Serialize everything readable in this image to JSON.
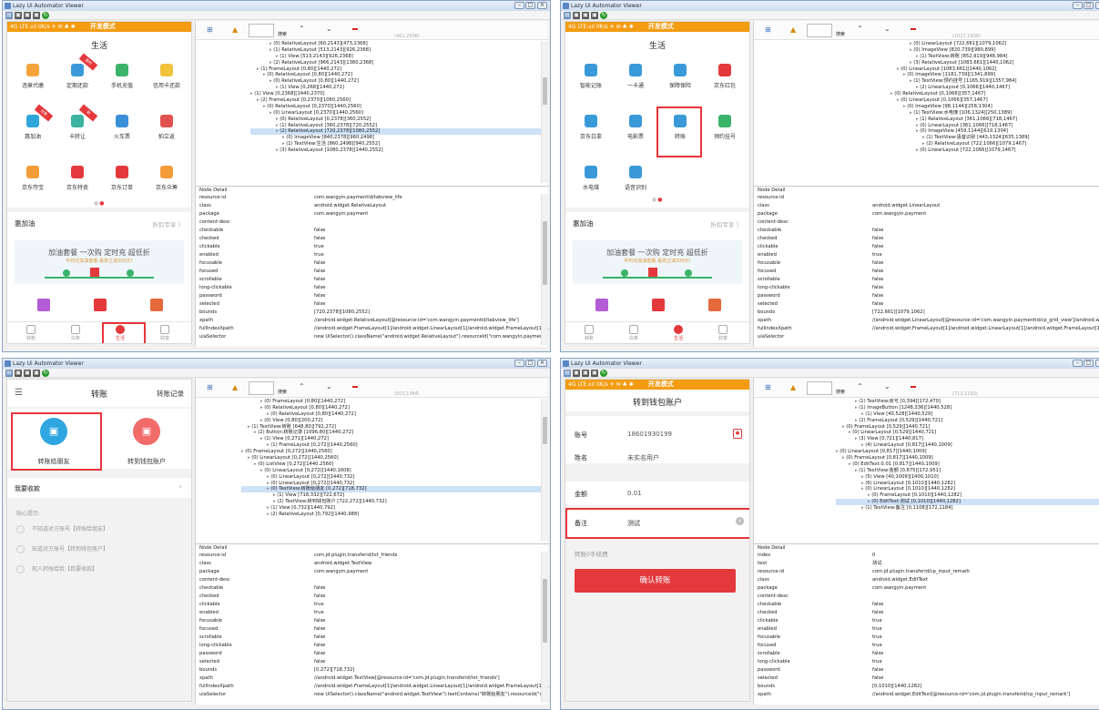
{
  "app": {
    "title": "Lazy Ui Automator Viewer",
    "search_label": "搜索"
  },
  "status": {
    "left": "4G LTE.ıııl 0K/s ✈ ✉ ♣ ✱",
    "dev_mode": "开发模式",
    "right": "◐ ◉ ⊙ ▮"
  },
  "panels": [
    {
      "coord_text": "(461,2506)",
      "phone_title": "生活",
      "grid": [
        {
          "label": "违章代缴",
          "color": "#f3a33a",
          "icon": "car-icon"
        },
        {
          "label": "定期还款",
          "color": "#3a9ad9",
          "icon": "clock-icon",
          "badge": "限时"
        },
        {
          "label": "手机充值",
          "color": "#3bb36a",
          "icon": "phone-charge-icon"
        },
        {
          "label": "信用卡还款",
          "color": "#f0c33a",
          "icon": "card-icon"
        },
        {
          "label": "惠加油",
          "color": "#2fa6d9",
          "icon": "fuel-icon",
          "badge": "优惠"
        },
        {
          "label": "卡转让",
          "color": "#3bb3a0",
          "icon": "card-transfer-icon",
          "badge": "新"
        },
        {
          "label": "火车票",
          "color": "#3a8fd9",
          "icon": "train-icon"
        },
        {
          "label": "拍立返",
          "color": "#e0524f",
          "icon": "camera-icon"
        },
        {
          "label": "京东夺宝",
          "color": "#f39c3a",
          "icon": "treasure-icon"
        },
        {
          "label": "京东特卖",
          "color": "#e4393c",
          "icon": "cart-icon"
        },
        {
          "label": "京东订单",
          "color": "#e4393c",
          "icon": "jd-icon"
        },
        {
          "label": "京东众筹",
          "color": "#f39c3a",
          "icon": "crowdfund-icon"
        }
      ],
      "section_title": "惠加油",
      "section_link": "折扣专享 〉",
      "banner_title": "加油套餐 一次购 定时充 超低折",
      "banner_sub": "中石化加油套餐 最高立减300元!",
      "nav": [
        "转账",
        "白条",
        "生活",
        "财富"
      ],
      "nav_active": 2,
      "tree": [
        "(0) RelativeLayout [60,2143][473,2368]",
        "(1) RelativeLayout [513,2143][926,2368]",
        "(1) View [513,2143][926,2368]",
        "(2) RelativeLayout [966,2143][1380,2368]",
        "(1) FrameLayout [0,80][1440,272]",
        "(0) RelativeLayout [0,80][1440,272]",
        "(0) RelativeLayout [0,80][1440,272]",
        "(1) View [0,268][1440,272]",
        "(1) View [0,2368][1440,2370]",
        "(2) FrameLayout [0,2370][1060,2560]",
        "(0) RelativeLayout [0,2370][1440,2560]",
        "(0) LinearLayout [0,2370][1440,2560]",
        "(0) RelativeLayout [0,2378][360,2552]",
        "(1) RelativeLayout [360,2378][720,2552]",
        "(2) RelativeLayout [720,2378][1080,2552]",
        "(0) ImageView [840,2378][960,2498]",
        "(1) TextView:生活 [860,2498][940,2552]",
        "(3) RelativeLayout [1080,2378][1440,2552]"
      ],
      "tree_sel": 14,
      "detail_header": "Node Detail",
      "details": [
        [
          "resource-id",
          "com.wangyin.paymentid/tabview_life"
        ],
        [
          "class",
          "android.widget.RelativeLayout"
        ],
        [
          "package",
          "com.wangyin.payment"
        ],
        [
          "content-desc",
          ""
        ],
        [
          "checkable",
          "false"
        ],
        [
          "checked",
          "false"
        ],
        [
          "clickable",
          "true"
        ],
        [
          "enabled",
          "true"
        ],
        [
          "focusable",
          "false"
        ],
        [
          "focused",
          "false"
        ],
        [
          "scrollable",
          "false"
        ],
        [
          "long-clickable",
          "false"
        ],
        [
          "password",
          "false"
        ],
        [
          "selected",
          "false"
        ],
        [
          "bounds",
          "[720,2378][1080,2552]"
        ],
        [
          "xpath",
          "//android.widget.RelativeLayout[@resource-id='com.wangyin.paymentid/tabview_life']"
        ],
        [
          "fullIndexXpath",
          "//android.widget.FrameLayout[1]/android.widget.LinearLayout[1]/android.widget.FrameLayout[1]/..."
        ],
        [
          "uiaSelector",
          "new UiSelector().className(\"android.widget.RelativeLayout\").resourceId(\"com.wangyin.paymen..."
        ]
      ]
    },
    {
      "coord_text": "(1017,1939)",
      "phone_title": "生活",
      "grid": [
        {
          "label": "智能记账",
          "color": "#3a9ad9",
          "icon": "ledger-icon"
        },
        {
          "label": "一卡通",
          "color": "#3a9ad9",
          "icon": "card-link-icon"
        },
        {
          "label": "保障保险",
          "color": "#3a9ad9",
          "icon": "umbrella-icon"
        },
        {
          "label": "京东红包",
          "color": "#e4393c",
          "icon": "red-packet-icon"
        },
        {
          "label": "京东白拿",
          "color": "#3a9ad9",
          "icon": "bag-icon"
        },
        {
          "label": "电影票",
          "color": "#3a9ad9",
          "icon": "film-icon"
        },
        {
          "label": "转账",
          "color": "#3a9ad9",
          "icon": "transfer-icon"
        },
        {
          "label": "预约挂号",
          "color": "#3bb36a",
          "icon": "hospital-icon"
        },
        {
          "label": "水电煤",
          "color": "#3a9ad9",
          "icon": "utility-icon"
        },
        {
          "label": "语音识别",
          "color": "#3a9ad9",
          "icon": "mic-icon"
        }
      ],
      "section_title": "惠加油",
      "section_link": "折扣专享 〉",
      "banner_title": "加油套餐 一次购 定时充 超低折",
      "banner_sub": "中石化加油套餐 最高立减300元!",
      "nav": [
        "转账",
        "白条",
        "生活",
        "财富"
      ],
      "nav_active": 2,
      "tree": [
        "(0) LinearLayout [722,661][1079,1062]",
        "(0) ImageView [820,739][980,899]",
        "(1) TextView:转账 [852,919][948,984]",
        "(3) RelativeLayout [1083,661][1440,1062]",
        "(0) LinearLayout [1083,661][1440,1062]",
        "(0) ImageView [1181,739][1341,899]",
        "(1) TextView:预约挂号 [1165,919][1357,984]",
        "(2) LinearLayout [0,1066][1440,1467]",
        "(0) RelativeLayout [0,1066][357,1467]",
        "(0) LinearLayout [0,1066][357,1467]",
        "(0) ImageView [98,1144][258,1304]",
        "(1) TextView:水电煤 [106,1324][250,1389]",
        "(1) RelativeLayout [361,1066][718,1467]",
        "(0) LinearLayout [361,1066][718,1467]",
        "(0) ImageView [459,1144][619,1304]",
        "(1) TextView:语音识别 [443,1324][635,1389]",
        "(2) RelativeLayout [722,1066][1079,1467]",
        "(0) LinearLayout [722,1066][1079,1467]"
      ],
      "tree_sel": -1,
      "detail_header": "Node Detail",
      "details": [
        [
          "resource-id",
          ""
        ],
        [
          "class",
          "android.widget.LinearLayout"
        ],
        [
          "package",
          "com.wangyin.payment"
        ],
        [
          "content-desc",
          ""
        ],
        [
          "checkable",
          "false"
        ],
        [
          "checked",
          "false"
        ],
        [
          "clickable",
          "false"
        ],
        [
          "enabled",
          "true"
        ],
        [
          "focusable",
          "false"
        ],
        [
          "focused",
          "false"
        ],
        [
          "scrollable",
          "false"
        ],
        [
          "long-clickable",
          "false"
        ],
        [
          "password",
          "false"
        ],
        [
          "selected",
          "false"
        ],
        [
          "bounds",
          "[722,661][1079,1062]"
        ],
        [
          "xpath",
          "//android.widget.LinearLayout[@resource-id='com.wangyin.paymentid/cp_grid_view']/android.wi..."
        ],
        [
          "fullIndexXpath",
          "//android.widget.FrameLayout[1]/android.widget.LinearLayout[1]/android.widget.FrameLayout[1]/..."
        ],
        [
          "uiaSelector",
          ""
        ]
      ]
    },
    {
      "coord_text": "(503,1384)",
      "page_title": "转账",
      "page_link": "转账记录",
      "big_buttons": [
        {
          "label": "转账给朋友",
          "color": "#2fa6e0",
          "icon": "friend-icon"
        },
        {
          "label": "转到钱包账户",
          "color": "#f26b6b",
          "icon": "wallet-icon"
        }
      ],
      "receive_label": "我要收款",
      "tips_title": "贴心提示:",
      "tips": [
        "不知道对方账号【转账给朋友】",
        "知道对方账号【转到钱包账户】",
        "现人转账给我【我要收款】"
      ],
      "tree": [
        "(0) FrameLayout [0,80][1440,272]",
        "(0) RelativeLayout [0,80][1440,272]",
        "(0) RelativeLayout [0,80][1440,272]",
        "(0) View [0,80][200,272]",
        "(1) TextView:转账 [648,80][792,272]",
        "(2) Button:转账记录 [1096,80][1440,272]",
        "(1) View [0,271][1440,272]",
        "(1) FrameLayout [0,272][1440,2560]",
        "(0) FrameLayout [0,272][1440,2560]",
        "(0) LinearLayout [0,272][1440,2560]",
        "(0) ListView [0,272][1440,2560]",
        "(0) LinearLayout [0,272][1440,1608]",
        "(0) LinearLayout [0,272][1440,732]",
        "(0) LinearLayout [0,272][1440,732]",
        "(0) TextView:转账给朋友 [0,272][718,732]",
        "(1) View [718,332][722,672]",
        "(2) TextView:转到钱包账户 [722,272][1440,732]",
        "(1) View [0,732][1440,792]",
        "(2) RelativeLayout [0,792][1440,988]"
      ],
      "tree_sel": 14,
      "detail_header": "Node Detail",
      "details": [
        [
          "resource-id",
          "com.jd.plugin.transferid/txt_friends"
        ],
        [
          "class",
          "android.widget.TextView"
        ],
        [
          "package",
          "com.wangyin.payment"
        ],
        [
          "content-desc",
          ""
        ],
        [
          "checkable",
          "false"
        ],
        [
          "checked",
          "false"
        ],
        [
          "clickable",
          "true"
        ],
        [
          "enabled",
          "true"
        ],
        [
          "focusable",
          "false"
        ],
        [
          "focused",
          "false"
        ],
        [
          "scrollable",
          "false"
        ],
        [
          "long-clickable",
          "false"
        ],
        [
          "password",
          "false"
        ],
        [
          "selected",
          "false"
        ],
        [
          "bounds",
          "[0,272][718,732]"
        ],
        [
          "xpath",
          "//android.widget.TextView[@resource-id='com.jd.plugin.transferid/txt_friends']"
        ],
        [
          "fullIndexXpath",
          "//android.widget.FrameLayout[1]/android.widget.LinearLayout[1]/android.widget.FrameLayout[1]/..."
        ],
        [
          "uiaSelector",
          "new UiSelector().className(\"android.widget.TextView\").textContains(\"转账给朋友\").resourceId(\"c..."
        ]
      ]
    },
    {
      "coord_text": "(712,1150)",
      "page_title": "转到钱包账户",
      "fields": [
        {
          "label": "账号",
          "value": "18601930199"
        },
        {
          "label": "姓名",
          "value": "未实名用户"
        },
        {
          "label": "金额",
          "value": "0.01"
        },
        {
          "label": "备注",
          "value": "测试"
        }
      ],
      "fee_text": "转账0手续费",
      "confirm": "确认转账",
      "tree": [
        "(1) TextView:账号 [0,394][172,470]",
        "(1) ImageButton [1248,336][1440,528]",
        "(1) View [40,528][1440,529]",
        "(2) FrameLayout [0,529][1440,721]",
        "(0) FrameLayout [0,529][1440,721]",
        "(0) LinearLayout [0,529][1440,721]",
        "(3) View [0,721][1440,817]",
        "(4) LinearLayout [0,817][1440,1009]",
        "(0) LinearLayout [0,817][1440,1009]",
        "(0) FrameLayout [0,817][1440,1009]",
        "(0) EditText:0.01 [0,817][1440,1009]",
        "(1) TextView:金额 [0,875][172,951]",
        "(5) View [40,1009][1400,1010]",
        "(6) LinearLayout [0,1010][1440,1282]",
        "(0) LinearLayout [0,1010][1440,1282]",
        "(0) FrameLayout [0,1010][1440,1282]",
        "(0) EditText:测试 [0,1010][1440,1282]",
        "(1) TextView:备注 [0,1108][172,1184]"
      ],
      "tree_sel": 16,
      "detail_header": "Node Detail",
      "details": [
        [
          "index",
          "0"
        ],
        [
          "text",
          "测试"
        ],
        [
          "resource-id",
          "com.jd.plugin.transferid/cp_input_remark"
        ],
        [
          "class",
          "android.widget.EditText"
        ],
        [
          "package",
          "com.wangyin.payment"
        ],
        [
          "content-desc",
          ""
        ],
        [
          "checkable",
          "false"
        ],
        [
          "checked",
          "false"
        ],
        [
          "clickable",
          "true"
        ],
        [
          "enabled",
          "true"
        ],
        [
          "focusable",
          "true"
        ],
        [
          "focused",
          "true"
        ],
        [
          "scrollable",
          "false"
        ],
        [
          "long-clickable",
          "true"
        ],
        [
          "password",
          "false"
        ],
        [
          "selected",
          "false"
        ],
        [
          "bounds",
          "[0,1010][1440,1282]"
        ],
        [
          "xpath",
          "//android.widget.EditText[@resource-id='com.jd.plugin.transferid/cp_input_remark']"
        ]
      ]
    }
  ]
}
